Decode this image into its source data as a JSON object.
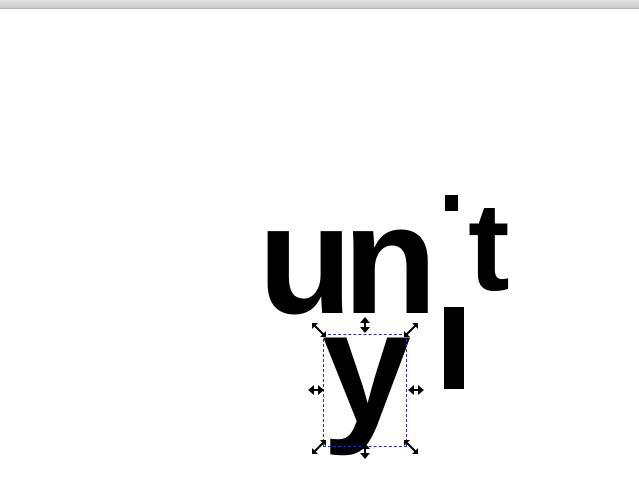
{
  "canvas": {
    "glyphs": {
      "word_un": "un",
      "letter_t": "t",
      "letter_y": "y"
    }
  },
  "selection": {
    "border_color": "#2b2bd0",
    "handle_icon": "scale-arrow-icon"
  }
}
